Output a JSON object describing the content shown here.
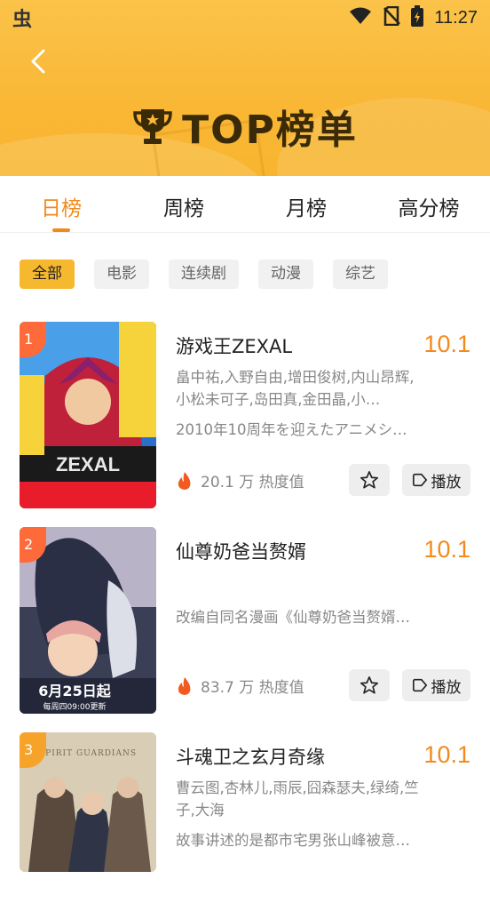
{
  "status_bar": {
    "app_badge": "虫",
    "time": "11:27"
  },
  "header": {
    "title": "TOP榜单"
  },
  "tabs": [
    {
      "label": "日榜",
      "active": true
    },
    {
      "label": "周榜",
      "active": false
    },
    {
      "label": "月榜",
      "active": false
    },
    {
      "label": "高分榜",
      "active": false
    }
  ],
  "filters": [
    {
      "label": "全部",
      "active": true
    },
    {
      "label": "电影",
      "active": false
    },
    {
      "label": "连续剧",
      "active": false
    },
    {
      "label": "动漫",
      "active": false
    },
    {
      "label": "综艺",
      "active": false
    }
  ],
  "items": [
    {
      "rank": "1",
      "title": "游戏王ZEXAL",
      "score": "10.1",
      "cast": "畠中祐,入野自由,增田俊树,内山昂辉,小松未可子,岛田真,金田晶,小…",
      "desc": "2010年10周年を迎えたアニメシ…",
      "heat": "20.1 万 热度值",
      "play_label": "播放"
    },
    {
      "rank": "2",
      "title": "仙尊奶爸当赘婿",
      "score": "10.1",
      "cast": "",
      "desc": "改编自同名漫画《仙尊奶爸当赘婿…",
      "heat": "83.7 万 热度值",
      "play_label": "播放",
      "poster_text": "6月25日起",
      "poster_sub": "每周四09:00更新"
    },
    {
      "rank": "3",
      "title": "斗魂卫之玄月奇缘",
      "score": "10.1",
      "cast": "曹云图,杏林儿,雨辰,囧森瑟夫,绿绮,竺子,大海",
      "desc": "故事讲述的是都市宅男张山峰被意…",
      "poster_text": "SPIRIT GUARDIANS"
    }
  ],
  "colors": {
    "accent": "#f08a1c",
    "header": "#f9b735",
    "rank_badge": "#ff6a3a"
  }
}
